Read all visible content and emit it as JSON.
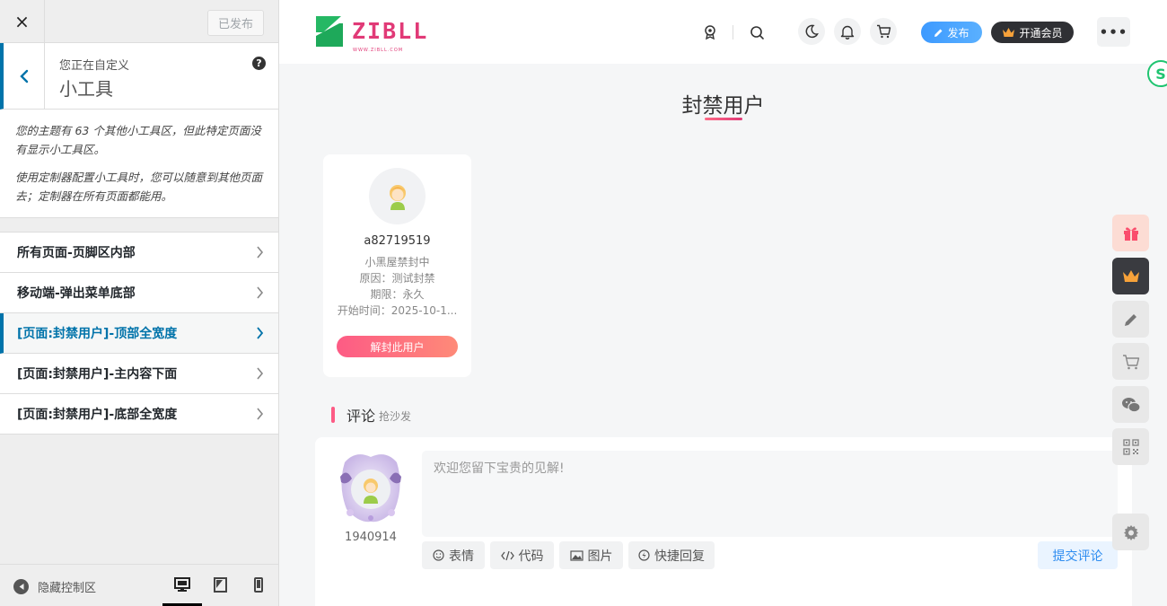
{
  "customizer": {
    "close_label": "×",
    "publish_label": "已发布",
    "header": {
      "subtitle": "您正在自定义",
      "title": "小工具",
      "help": "?"
    },
    "description": [
      "您的主题有 63 个其他小工具区，但此特定页面没有显示小工具区。",
      "使用定制器配置小工具时，您可以随意到其他页面去；定制器在所有页面都能用。"
    ],
    "items": [
      {
        "label": "所有页面-页脚区内部"
      },
      {
        "label": "移动端-弹出菜单底部"
      },
      {
        "label": "[页面:封禁用户]-顶部全宽度"
      },
      {
        "label": "[页面:封禁用户]-主内容下面"
      },
      {
        "label": "[页面:封禁用户]-底部全宽度"
      }
    ],
    "active_index": 2,
    "footer": {
      "hide_label": "隐藏控制区",
      "devices": [
        "desktop-icon",
        "tablet-icon",
        "mobile-icon"
      ],
      "active_device": "desktop"
    }
  },
  "site": {
    "logo_text": "ZIBLL",
    "logo_sub": "WWW.ZIBLL.COM",
    "post_label": "发布",
    "vip_label": "开通会员",
    "more_label": "•••",
    "accent": "#e13a77"
  },
  "page": {
    "title": "封禁用户",
    "user": {
      "name": "a82719519",
      "status": "小黑屋禁封中",
      "reason": "原因：测试封禁",
      "term": "期限：永久",
      "start": "开始时间：2025-10-1...",
      "unban_label": "解封此用户"
    },
    "comments": {
      "title": "评论",
      "subtitle": "抢沙发",
      "commenter_name": "1940914",
      "placeholder": "欢迎您留下宝贵的见解!",
      "tools": [
        "表情",
        "代码",
        "图片",
        "快捷回复"
      ],
      "submit_label": "提交评论"
    }
  }
}
